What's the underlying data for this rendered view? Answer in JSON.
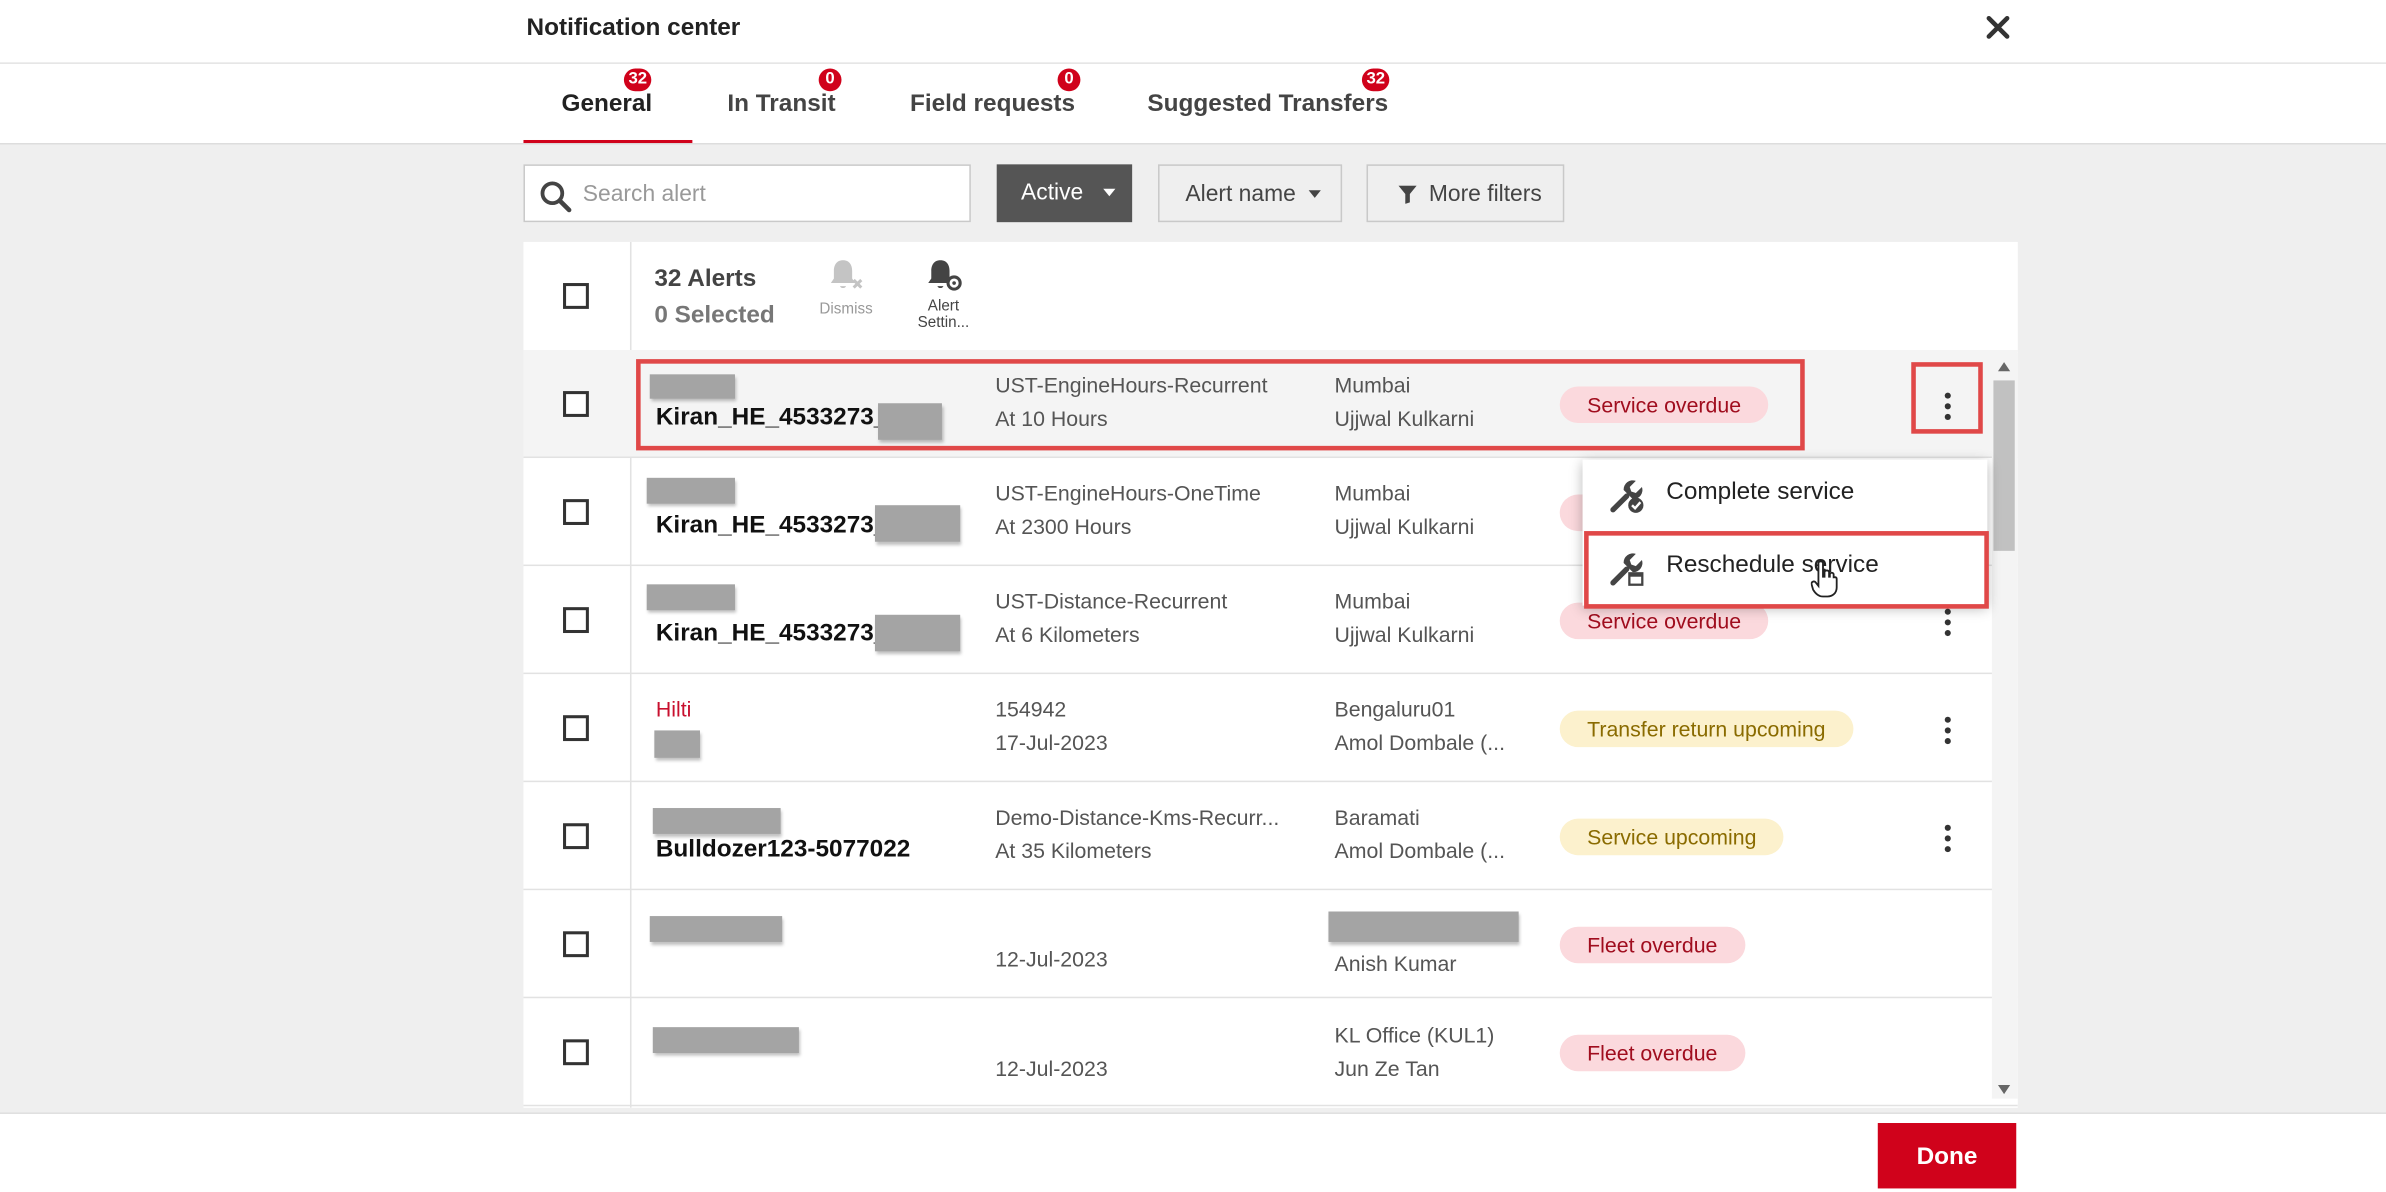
{
  "header": {
    "title": "Notification center"
  },
  "tabs": [
    {
      "label": "General",
      "badge": "32"
    },
    {
      "label": "In Transit",
      "badge": "0"
    },
    {
      "label": "Field requests",
      "badge": "0"
    },
    {
      "label": "Suggested Transfers",
      "badge": "32"
    }
  ],
  "filters": {
    "search_placeholder": "Search alert",
    "status_label": "Active",
    "alert_name_label": "Alert name",
    "more_filters_label": "More filters"
  },
  "table_header": {
    "count_label": "32 Alerts",
    "selected_label": "0 Selected",
    "dismiss_label": "Dismiss",
    "alert_settings_label_line1": "Alert",
    "alert_settings_label_line2": "Settin..."
  },
  "rows": [
    {
      "name": "Kiran_HE_4533273_",
      "alert": "UST-EngineHours-Recurrent",
      "detail": "At 10 Hours",
      "location": "Mumbai",
      "person": "Ujjwal Kulkarni",
      "status": "Service overdue"
    },
    {
      "name": "Kiran_HE_4533273_",
      "alert": "UST-EngineHours-OneTime",
      "detail": "At 2300 Hours",
      "location": "Mumbai",
      "person": "Ujjwal Kulkarni",
      "status": ""
    },
    {
      "name": "Kiran_HE_4533273_",
      "alert": "UST-Distance-Recurrent",
      "detail": "At 6 Kilometers",
      "location": "Mumbai",
      "person": "Ujjwal Kulkarni",
      "status": "Service overdue"
    },
    {
      "brand": "Hilti",
      "alert": "154942",
      "detail": "17-Jul-2023",
      "location": "Bengaluru01",
      "person": "Amol Dombale (...",
      "status": "Transfer return upcoming"
    },
    {
      "name": "Bulldozer123-5077022",
      "alert": "Demo-Distance-Kms-Recurr...",
      "detail": "At 35 Kilometers",
      "location": "Baramati",
      "person": "Amol Dombale (...",
      "status": "Service upcoming"
    },
    {
      "detail": "12-Jul-2023",
      "person": "Anish Kumar",
      "status": "Fleet overdue"
    },
    {
      "detail": "12-Jul-2023",
      "location": "KL Office (KUL1)",
      "person": "Jun Ze Tan",
      "status": "Fleet overdue"
    }
  ],
  "row_menu": {
    "items": [
      {
        "label": "Complete service",
        "icon": "wrench-check-icon"
      },
      {
        "label": "Reschedule service",
        "icon": "wrench-calendar-icon"
      }
    ]
  },
  "footer": {
    "done_label": "Done"
  },
  "colors": {
    "accent": "#d0021b",
    "overdue_bg": "#fbd9dd",
    "upcoming_bg": "#fcf1cd",
    "annotation": "#e04848"
  }
}
